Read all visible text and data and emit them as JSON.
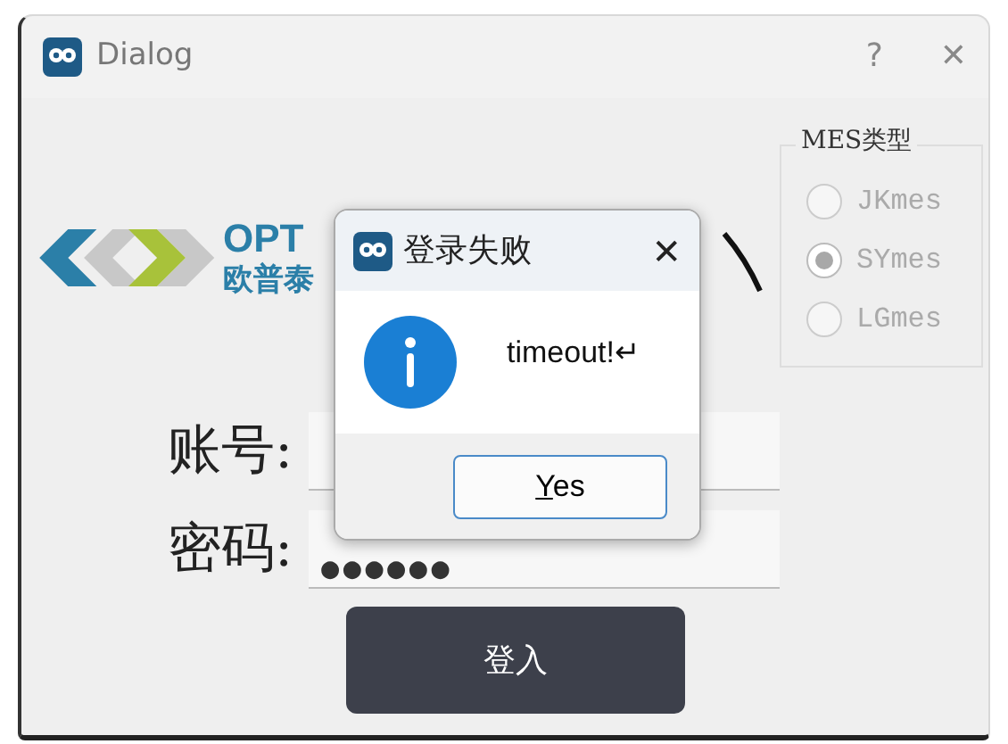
{
  "window": {
    "title": "Dialog",
    "help": "?",
    "close": "✕"
  },
  "logo": {
    "line_1": "OPT",
    "line_2": "欧普泰"
  },
  "mes_group": {
    "title": "MES类型",
    "options": [
      {
        "label": "JKmes",
        "selected": false
      },
      {
        "label": "SYmes",
        "selected": true
      },
      {
        "label": "LGmes",
        "selected": false
      }
    ]
  },
  "fields": [
    {
      "label": "账号:"
    },
    {
      "label": "密码:",
      "value": "●●●●●●"
    }
  ],
  "login_button": "登入",
  "message_box": {
    "title": "登录失败",
    "close": "✕",
    "message": "timeout!↵",
    "button": {
      "mnemonic": "Y",
      "rest": "es"
    }
  }
}
